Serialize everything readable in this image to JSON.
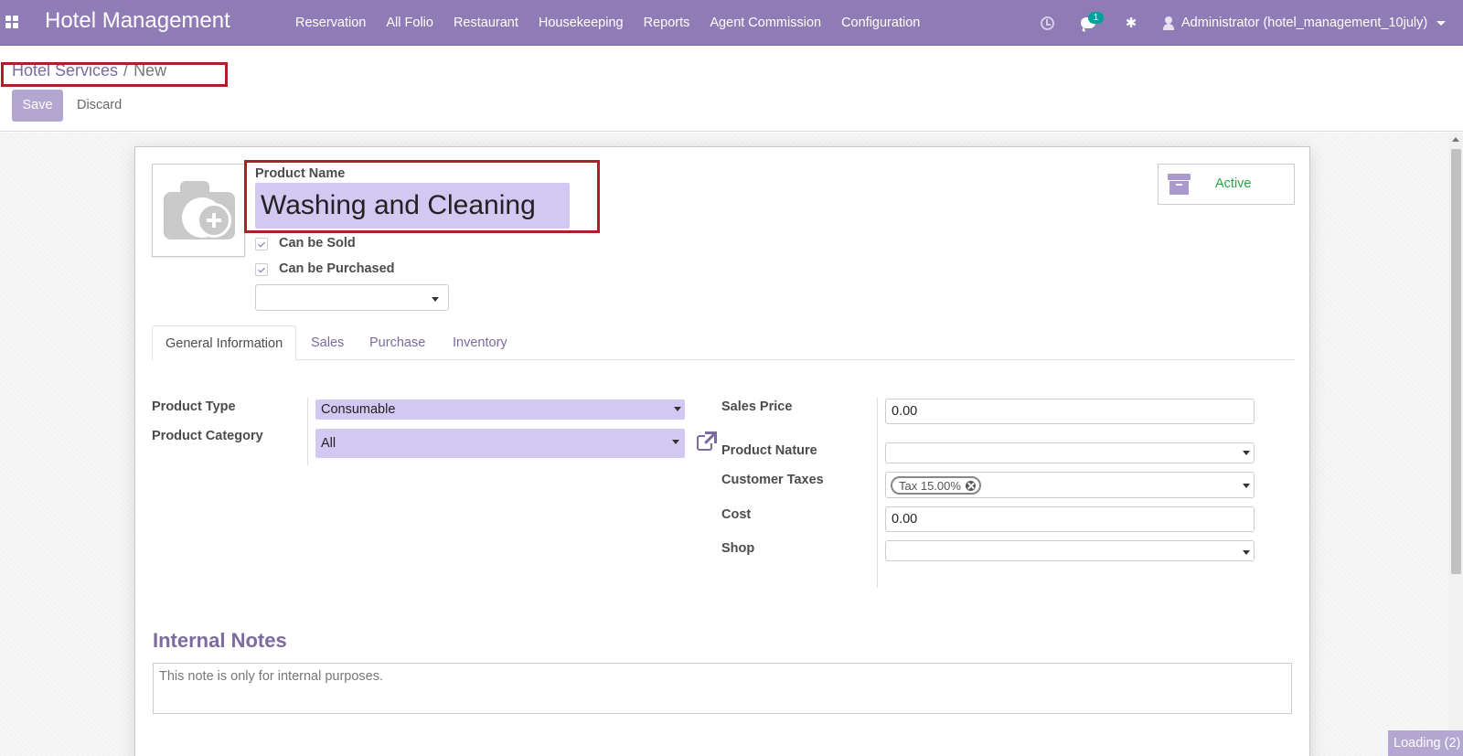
{
  "app": {
    "title": "Hotel Management",
    "menu": [
      "Reservation",
      "All Folio",
      "Restaurant",
      "Housekeeping",
      "Reports",
      "Agent Commission",
      "Configuration"
    ],
    "messages_count": "1",
    "user": "Administrator (hotel_management_10july)",
    "accent_color": "#8f7bb5"
  },
  "breadcrumb": {
    "parent": "Hotel Services",
    "separator": "/",
    "current": "New"
  },
  "buttons": {
    "save": "Save",
    "discard": "Discard"
  },
  "form": {
    "product_name_label": "Product Name",
    "product_name": "Washing and Cleaning",
    "can_be_sold": {
      "label": "Can be Sold",
      "checked": true
    },
    "can_be_purchased": {
      "label": "Can be Purchased",
      "checked": true
    },
    "active_label": "Active",
    "tabs": [
      {
        "label": "General Information",
        "active": true
      },
      {
        "label": "Sales",
        "active": false
      },
      {
        "label": "Purchase",
        "active": false
      },
      {
        "label": "Inventory",
        "active": false
      }
    ],
    "product_type": {
      "label": "Product Type",
      "value": "Consumable"
    },
    "product_category": {
      "label": "Product Category",
      "value": "All"
    },
    "sales_price": {
      "label": "Sales Price",
      "value": "0.00"
    },
    "product_nature": {
      "label": "Product Nature",
      "value": ""
    },
    "customer_taxes": {
      "label": "Customer Taxes",
      "tags": [
        "Tax 15.00%"
      ]
    },
    "cost": {
      "label": "Cost",
      "value": "0.00"
    },
    "shop": {
      "label": "Shop",
      "value": ""
    },
    "internal_notes_title": "Internal Notes",
    "internal_notes_placeholder": "This note is only for internal purposes."
  },
  "status": {
    "loading": "Loading (2)"
  }
}
